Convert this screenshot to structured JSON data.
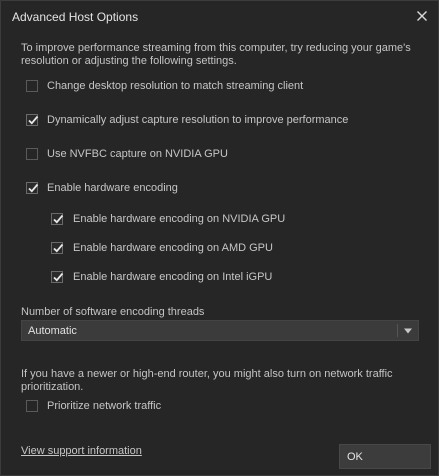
{
  "window": {
    "title": "Advanced Host Options"
  },
  "intro_text": "To improve performance streaming from this computer, try reducing your game's resolution or adjusting the following settings.",
  "options": [
    {
      "label": "Change desktop resolution to match streaming client",
      "checked": false
    },
    {
      "label": "Dynamically adjust capture resolution to improve performance",
      "checked": true
    },
    {
      "label": "Use NVFBC capture on NVIDIA GPU",
      "checked": false
    },
    {
      "label": "Enable hardware encoding",
      "checked": true
    },
    {
      "label": "Enable hardware encoding on NVIDIA GPU",
      "checked": true
    },
    {
      "label": "Enable hardware encoding on AMD GPU",
      "checked": true
    },
    {
      "label": "Enable hardware encoding on Intel iGPU",
      "checked": true
    }
  ],
  "encoding_threads": {
    "label": "Number of software encoding threads",
    "selected": "Automatic"
  },
  "router_text": "If you have a newer or high-end router, you might also turn on network traffic prioritization.",
  "network_option": {
    "label": "Prioritize network traffic",
    "checked": false
  },
  "footer": {
    "support_link": "View support information",
    "ok_label": "OK"
  },
  "colors": {
    "background": "#262626",
    "button": "#3c3c3c",
    "text": "#c6c6c6",
    "checkmark": "#e8e8e8"
  }
}
